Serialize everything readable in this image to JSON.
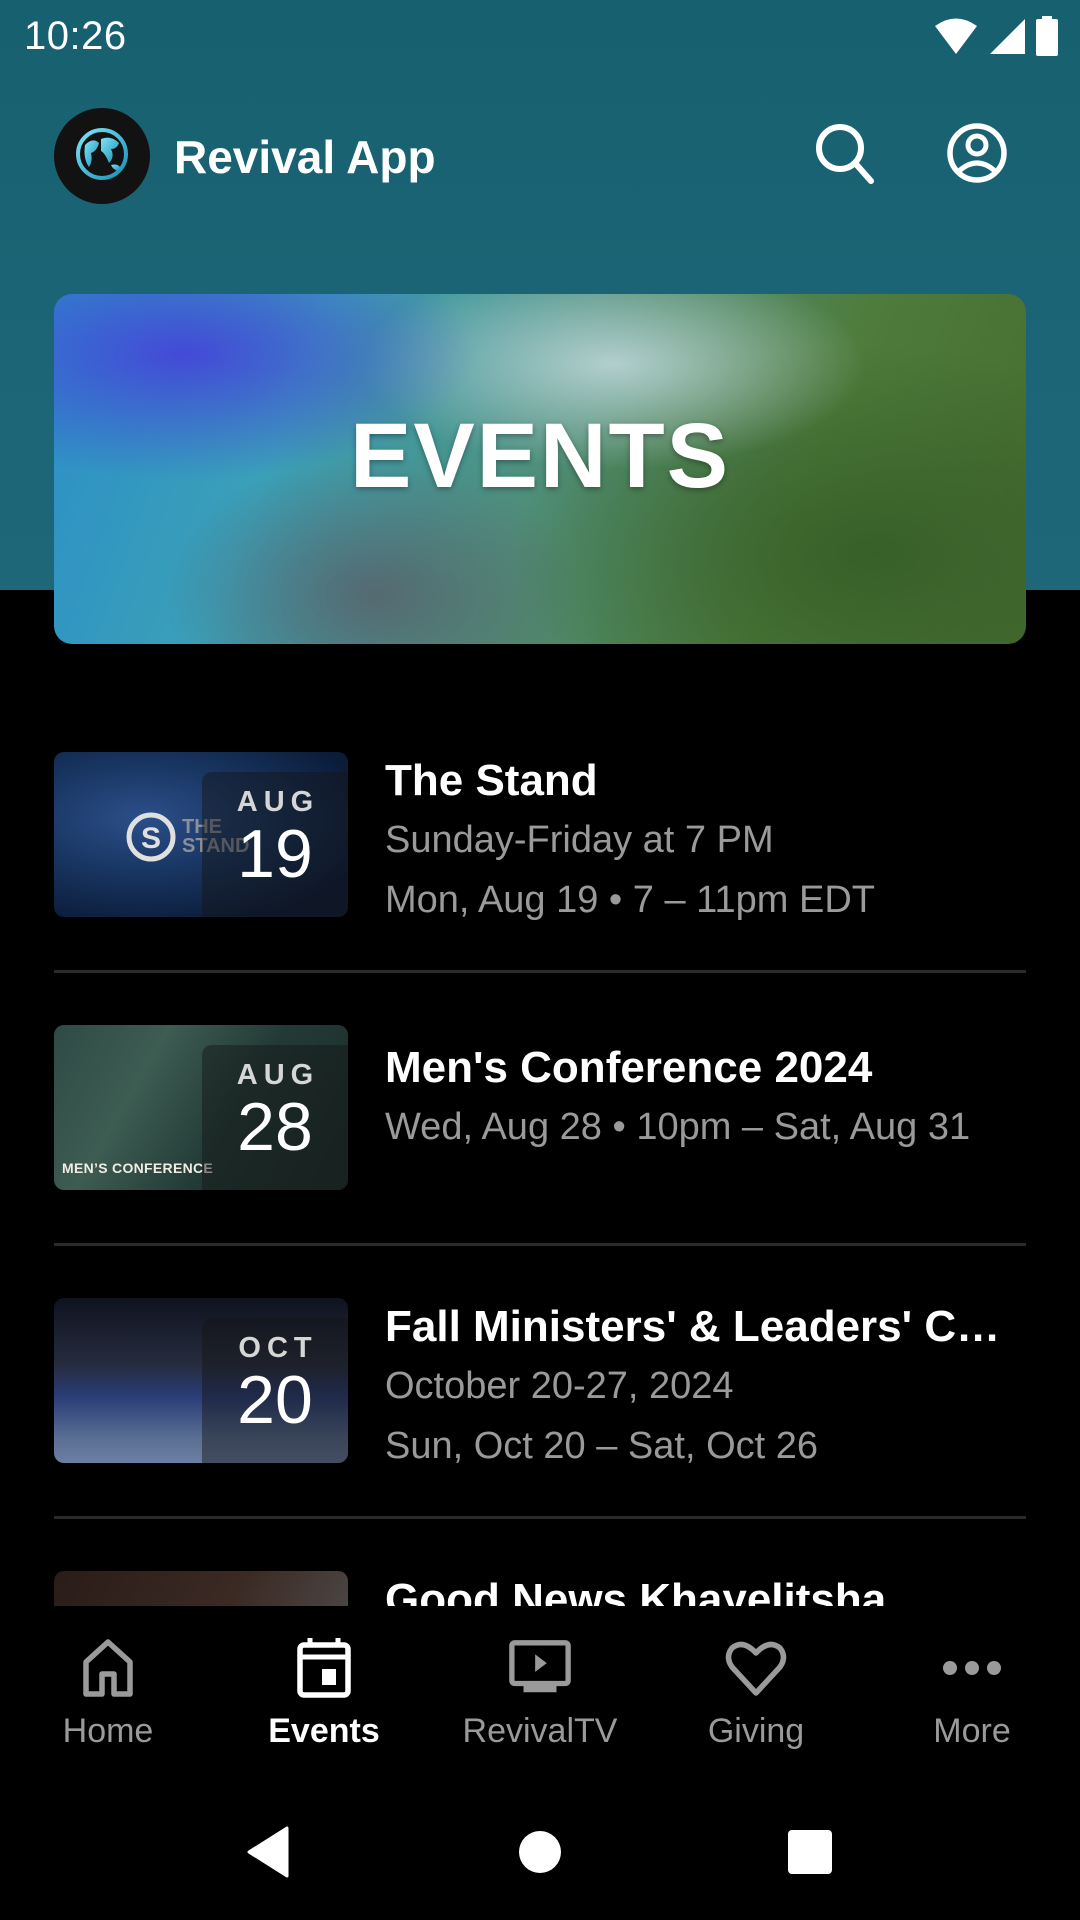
{
  "status_bar": {
    "time": "10:26",
    "icons": [
      "wifi-icon",
      "cellular-signal-icon",
      "battery-icon"
    ]
  },
  "app_bar": {
    "title": "Revival App",
    "logo_icon": "globe-logo-icon",
    "actions": [
      {
        "name": "search",
        "icon": "search-icon"
      },
      {
        "name": "account",
        "icon": "account-circle-icon"
      }
    ]
  },
  "hero": {
    "title": "EVENTS"
  },
  "events": [
    {
      "title": "The Stand",
      "lines": [
        "Sunday-Friday at 7 PM",
        "Mon, Aug 19 • 7 – 11pm EDT"
      ],
      "month": "AUG",
      "day": "19",
      "thumb_text": [
        "THE",
        "STAND"
      ]
    },
    {
      "title": "Men's Conference 2024",
      "lines": [
        "Wed, Aug 28 • 10pm – Sat, Aug 31"
      ],
      "month": "AUG",
      "day": "28",
      "thumb_caption": "MEN’S CONFERENCE"
    },
    {
      "title": "Fall Ministers' & Leaders' Conference",
      "lines": [
        "October 20-27, 2024",
        "Sun, Oct 20 – Sat, Oct 26"
      ],
      "month": "OCT",
      "day": "20"
    },
    {
      "title": "Good News Khayelitsha",
      "lines": []
    }
  ],
  "bottom_nav": {
    "active": "Events",
    "items": [
      {
        "label": "Home",
        "icon": "home-icon"
      },
      {
        "label": "Events",
        "icon": "calendar-icon"
      },
      {
        "label": "RevivalTV",
        "icon": "tv-play-icon"
      },
      {
        "label": "Giving",
        "icon": "heart-icon"
      },
      {
        "label": "More",
        "icon": "more-horizontal-icon"
      }
    ]
  },
  "system_nav": {
    "buttons": [
      "back",
      "home",
      "recents"
    ]
  }
}
